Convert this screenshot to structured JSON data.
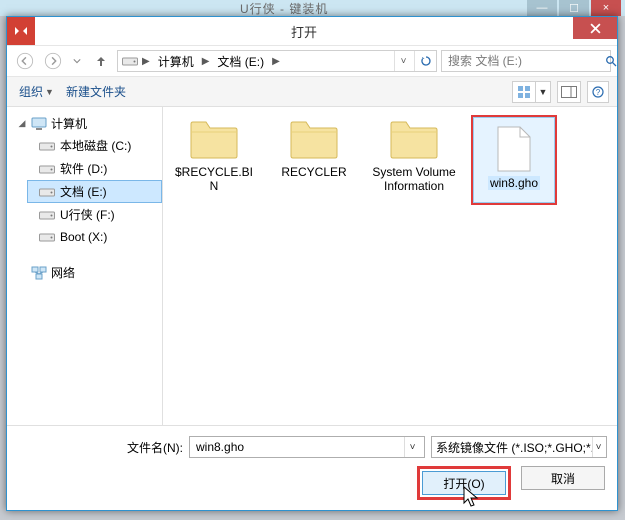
{
  "bg": {
    "title": "U行侠 - 键装机",
    "min": "—",
    "max": "☐",
    "close": "×"
  },
  "dialog": {
    "title": "打开",
    "close_icon": "close-icon"
  },
  "breadcrumb": {
    "root": "计算机",
    "segment": "文档 (E:)"
  },
  "search": {
    "placeholder": "搜索 文档 (E:)"
  },
  "toolbar": {
    "organize": "组织",
    "newfolder": "新建文件夹"
  },
  "tree": {
    "computer": "计算机",
    "drives": [
      {
        "label": "本地磁盘 (C:)"
      },
      {
        "label": "软件 (D:)"
      },
      {
        "label": "文档 (E:)",
        "selected": true
      },
      {
        "label": "U行侠 (F:)"
      },
      {
        "label": "Boot (X:)"
      }
    ],
    "network": "网络"
  },
  "files": [
    {
      "name": "$RECYCLE.BIN",
      "type": "folder"
    },
    {
      "name": "RECYCLER",
      "type": "folder"
    },
    {
      "name": "System Volume Information",
      "type": "folder"
    },
    {
      "name": "win8.gho",
      "type": "file",
      "selected": true
    }
  ],
  "footer": {
    "filename_label": "文件名(N):",
    "filename_value": "win8.gho",
    "filter": "系统镜像文件 (*.ISO;*.GHO;*.WIM)",
    "open": "打开(O)",
    "cancel": "取消"
  }
}
